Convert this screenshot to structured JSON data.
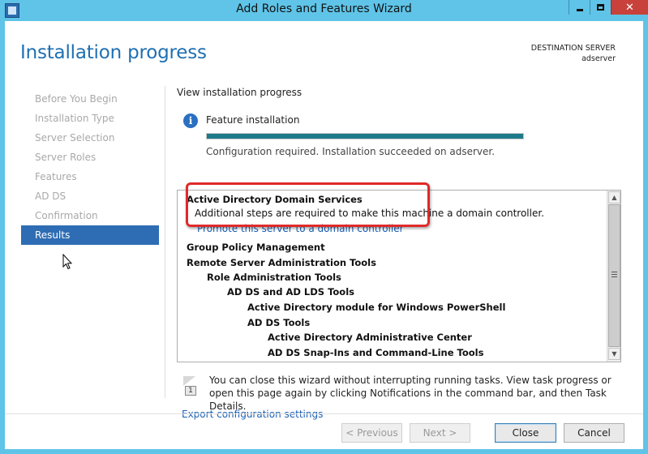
{
  "window": {
    "title": "Add Roles and Features Wizard",
    "minimize_icon": "minimize-icon",
    "maximize_icon": "maximize-icon",
    "close_glyph": "✕"
  },
  "page": {
    "title": "Installation progress",
    "destination_label": "DESTINATION SERVER",
    "destination_server": "adserver"
  },
  "nav": {
    "items": [
      {
        "label": "Before You Begin",
        "active": false
      },
      {
        "label": "Installation Type",
        "active": false
      },
      {
        "label": "Server Selection",
        "active": false
      },
      {
        "label": "Server Roles",
        "active": false
      },
      {
        "label": "Features",
        "active": false
      },
      {
        "label": "AD DS",
        "active": false
      },
      {
        "label": "Confirmation",
        "active": false
      },
      {
        "label": "Results",
        "active": true
      }
    ]
  },
  "main": {
    "section_title": "View installation progress",
    "info_glyph": "i",
    "feature_label": "Feature installation",
    "progress_percent": 100,
    "status_text": "Configuration required. Installation succeeded on adserver.",
    "results": [
      {
        "text": "Active Directory Domain Services",
        "style": "bold"
      },
      {
        "text": "Additional steps are required to make this machine a domain controller.",
        "style": "normal"
      },
      {
        "text": "Promote this server to a domain controller",
        "style": "link"
      },
      {
        "text": "Group Policy Management",
        "style": "bold"
      },
      {
        "text": "Remote Server Administration Tools",
        "style": "bold"
      },
      {
        "text": "Role Administration Tools",
        "style": "bold"
      },
      {
        "text": "AD DS and AD LDS Tools",
        "style": "bold"
      },
      {
        "text": "Active Directory module for Windows PowerShell",
        "style": "bold"
      },
      {
        "text": "AD DS Tools",
        "style": "bold"
      },
      {
        "text": "Active Directory Administrative Center",
        "style": "bold"
      },
      {
        "text": "AD DS Snap-Ins and Command-Line Tools",
        "style": "bold"
      }
    ],
    "scroll_up_glyph": "▲",
    "scroll_down_glyph": "▼",
    "note_badge": "1",
    "note_text": "You can close this wizard without interrupting running tasks. View task progress or open this page again by clicking Notifications in the command bar, and then Task Details.",
    "export_link": "Export configuration settings"
  },
  "buttons": {
    "previous": "< Previous",
    "next": "Next >",
    "close": "Close",
    "cancel": "Cancel"
  },
  "colors": {
    "accent": "#1f6fb2",
    "nav_active": "#2e6db4",
    "progress": "#1e7a8a",
    "callout": "#e02a2a",
    "link": "#1a5fb4"
  }
}
